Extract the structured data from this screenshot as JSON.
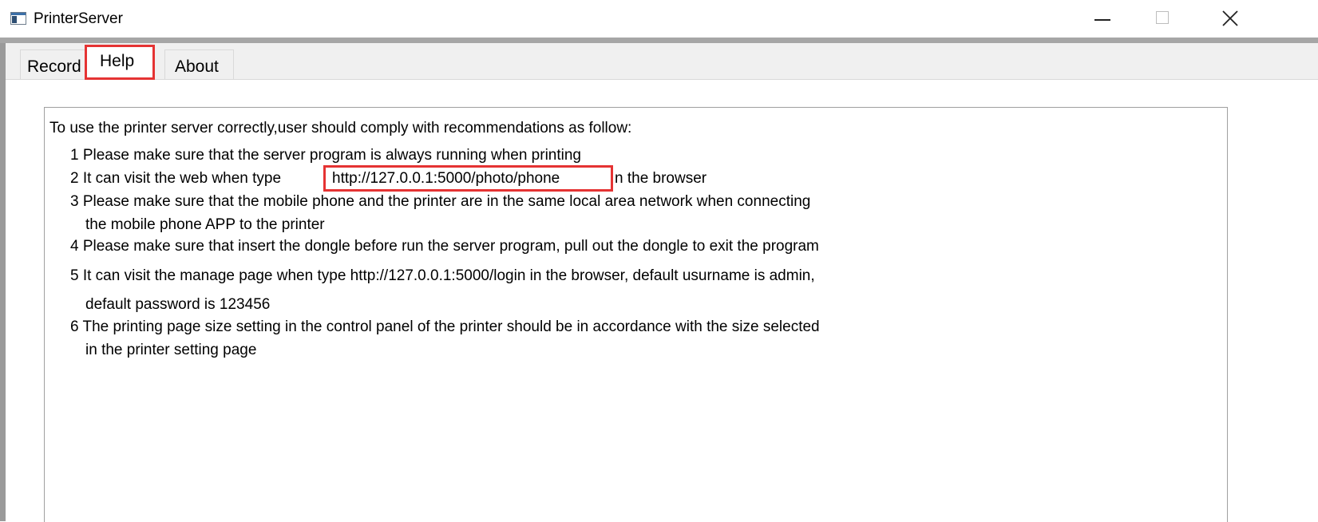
{
  "window": {
    "title": "PrinterServer",
    "icon": "app-window-icon",
    "controls": [
      "minimize-icon",
      "maximize-icon",
      "close-icon"
    ]
  },
  "tabs": [
    {
      "label": "Record",
      "selected": false
    },
    {
      "label": "Help",
      "selected": true
    },
    {
      "label": "About",
      "selected": false
    }
  ],
  "help": {
    "intro": "To use the printer server correctly,user should comply with recommendations as follow:",
    "item1": "1 Please make sure that the server program is always running when printing",
    "item2_prefix": "2 It can visit the web when type",
    "item2_url": "http://127.0.0.1:5000/photo/phone",
    "item2_suffix": "n the browser",
    "item3_line1": "3 Please make sure that the mobile phone and the printer are in the same local area network when connecting",
    "item3_line2": "the mobile phone APP to the printer",
    "item4": "4 Please make sure that insert the dongle before run the server program, pull out the dongle to exit the program",
    "item5_line1": "5 It can visit the manage page when type http://127.0.0.1:5000/login in the browser,  default usurname is admin,",
    "item5_line2": "default password is 123456",
    "item6_line1": "6 The printing page size setting in the control panel of the printer should be in accordance with the size selected",
    "item6_line2": "in the printer setting page"
  },
  "colors": {
    "highlight": "#e53333",
    "client_background": "#f0f0f0"
  }
}
